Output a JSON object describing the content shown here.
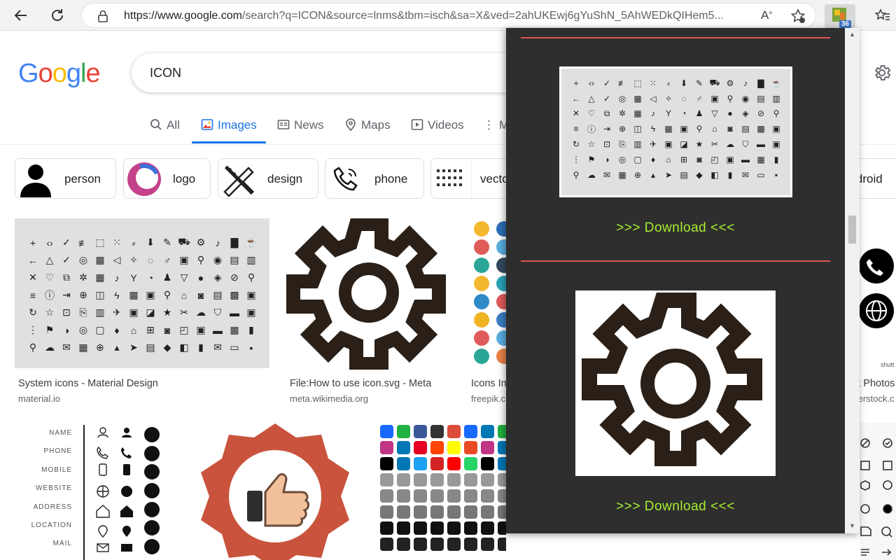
{
  "browser": {
    "url_prefix": "https://www.google.com",
    "url_rest": "/search?q=ICON&source=lnms&tbm=isch&sa=X&ved=2ahUKEwj6gYuShN_5AhWEDkQIHem5...",
    "extension_badge": "36"
  },
  "google": {
    "logo": "Google",
    "search_value": "ICON"
  },
  "tabs": [
    {
      "label": "All",
      "icon": "search-icon"
    },
    {
      "label": "Images",
      "icon": "image-icon"
    },
    {
      "label": "News",
      "icon": "news-icon"
    },
    {
      "label": "Maps",
      "icon": "pin-icon"
    },
    {
      "label": "Videos",
      "icon": "play-icon"
    },
    {
      "label": "Mo",
      "icon": "more-vert-icon"
    }
  ],
  "chips": [
    {
      "label": "person"
    },
    {
      "label": "logo"
    },
    {
      "label": "design"
    },
    {
      "label": "phone"
    },
    {
      "label": "vecto"
    },
    {
      "label": "android"
    }
  ],
  "results": [
    {
      "title": "System icons - Material Design",
      "source": "material.io"
    },
    {
      "title": "File:How to use icon.svg - Meta",
      "source": "meta.wikimedia.org"
    },
    {
      "title": "Icons Im",
      "source": "freepik.c"
    },
    {
      "title": "k Photos",
      "source": "terstock.c"
    }
  ],
  "contact_labels": [
    "NAME",
    "PHONE",
    "MOBILE",
    "WEBSITE",
    "ADDRESS",
    "LOCATION",
    "MAIL"
  ],
  "popup": {
    "download_1": ">>> Download <<<",
    "download_2": ">>> Download <<<"
  },
  "colors": {
    "accent": "#1a73e8",
    "popup_bg": "#2e2e2e",
    "popup_separator": "#e05454",
    "download_text": "#a8f030"
  }
}
